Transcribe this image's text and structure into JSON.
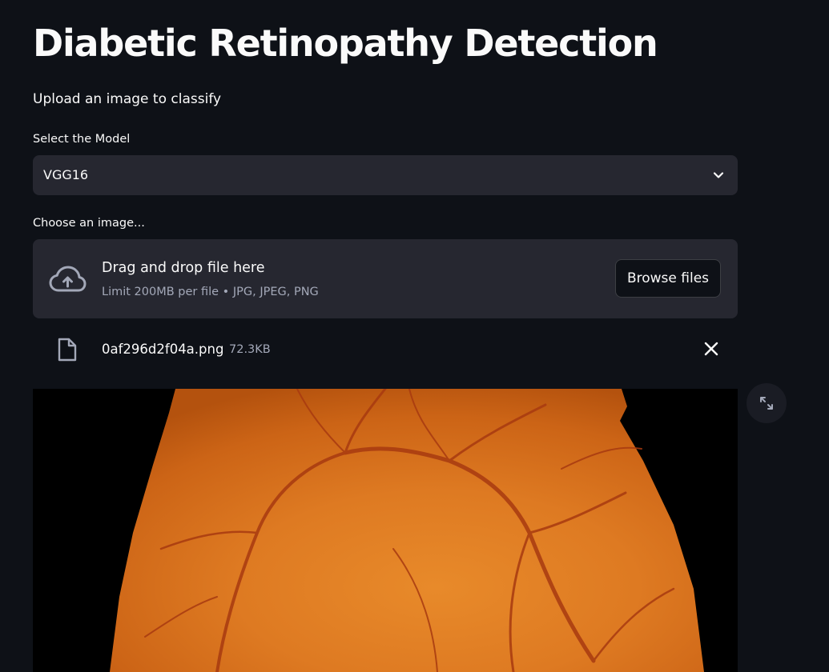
{
  "page": {
    "title": "Diabetic Retinopathy Detection",
    "subtitle": "Upload an image to classify"
  },
  "model_select": {
    "label": "Select the Model",
    "value": "VGG16"
  },
  "uploader": {
    "label": "Choose an image...",
    "drop_title": "Drag and drop file here",
    "limit_text": "Limit 200MB per file • JPG, JPEG, PNG",
    "browse_label": "Browse files",
    "icon": "cloud-upload-icon"
  },
  "uploaded_file": {
    "name": "0af296d2f04a.png",
    "size": "72.3KB",
    "icon": "file-icon"
  },
  "image": {
    "expand_icon": "fullscreen-icon"
  },
  "colors": {
    "background": "#0e1117",
    "widget_bg": "#262730",
    "text": "#fafafa",
    "muted_text": "#a3a8b8"
  }
}
